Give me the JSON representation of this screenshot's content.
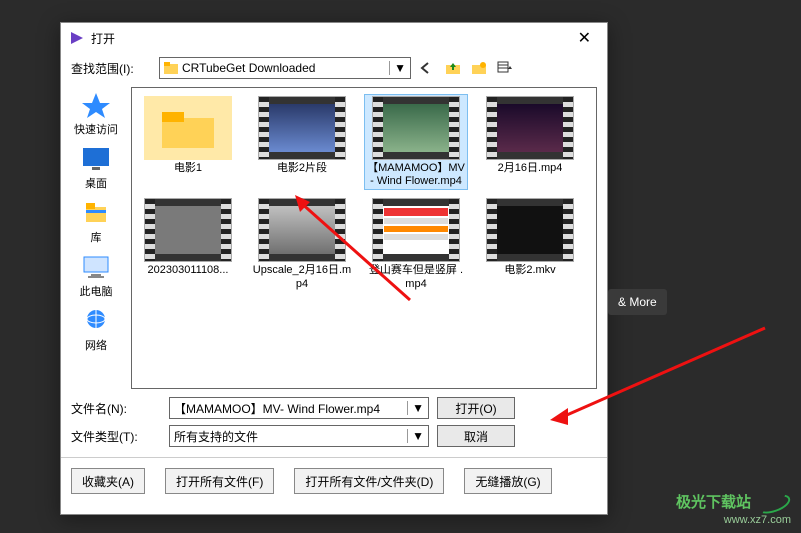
{
  "titlebar": {
    "title": "打开",
    "close": "✕"
  },
  "lookin": {
    "label": "查找范围(I):",
    "folder": "CRTubeGet Downloaded"
  },
  "places": [
    {
      "name": "快速访问"
    },
    {
      "name": "桌面"
    },
    {
      "name": "库"
    },
    {
      "name": "此电脑"
    },
    {
      "name": "网络"
    }
  ],
  "files": [
    {
      "name": "电影1",
      "kind": "folder"
    },
    {
      "name": "电影2片段",
      "kind": "video",
      "tone": "sky"
    },
    {
      "name": "【MAMAMOO】MV- Wind Flower.mp4",
      "kind": "video",
      "tone": "mv",
      "selected": true
    },
    {
      "name": "2月16日.mp4",
      "kind": "video",
      "tone": "dark"
    },
    {
      "name": "202303011108...",
      "kind": "video",
      "tone": "gray"
    },
    {
      "name": "Upscale_2月16日.mp4",
      "kind": "video",
      "tone": "crowd"
    },
    {
      "name": "登山赛车但是竖屏 .mp4",
      "kind": "video",
      "tone": "app"
    },
    {
      "name": "电影2.mkv",
      "kind": "video",
      "tone": "black"
    }
  ],
  "filename": {
    "label": "文件名(N):",
    "value": "【MAMAMOO】MV- Wind Flower.mp4"
  },
  "filetype": {
    "label": "文件类型(T):",
    "value": "所有支持的文件"
  },
  "open_btn": "打开(O)",
  "cancel_btn": "取消",
  "footer": {
    "favorites": "收藏夹(A)",
    "open_all": "打开所有文件(F)",
    "open_all_folders": "打开所有文件/文件夹(D)",
    "seamless": "无缝播放(G)"
  },
  "and_more": "& More",
  "watermark": {
    "brand": "极光下载站",
    "url": "www.xz7.com"
  }
}
